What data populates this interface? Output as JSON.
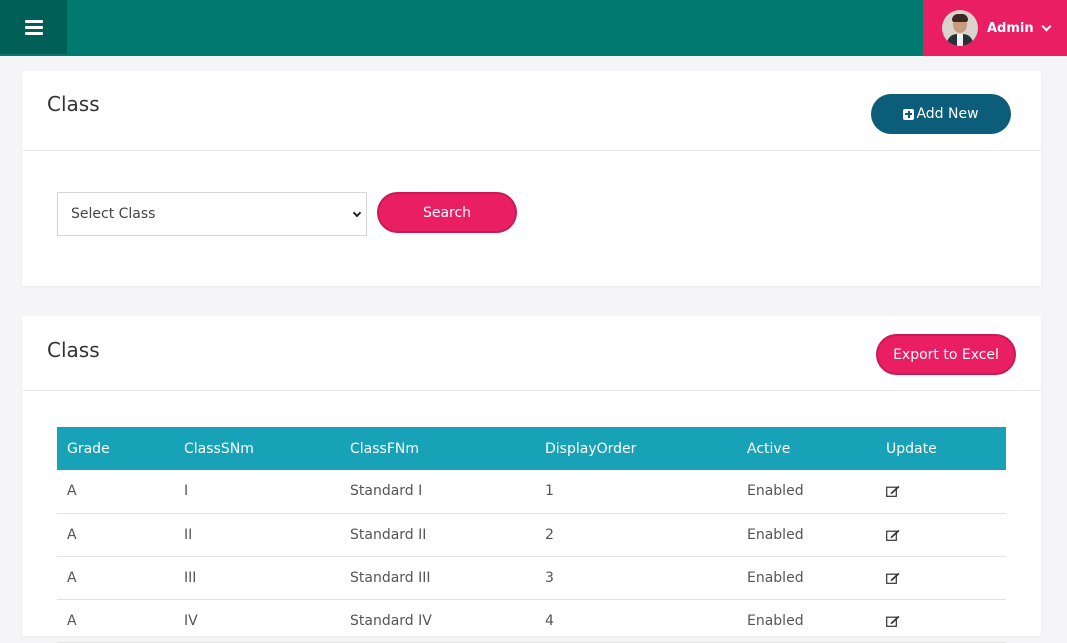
{
  "topbar": {
    "menu_icon": "hamburger-menu-icon",
    "user_name": "Admin",
    "colors": {
      "bar": "#00796f",
      "menu_bg": "#005f57",
      "user_bg": "#ea1f63"
    }
  },
  "filter_card": {
    "title": "Class",
    "add_new_label": "Add New",
    "select_placeholder": "Select Class",
    "search_label": "Search"
  },
  "list_card": {
    "title": "Class",
    "export_label": "Export to Excel",
    "columns": [
      "Grade",
      "ClassSNm",
      "ClassFNm",
      "DisplayOrder",
      "Active",
      "Update"
    ],
    "rows": [
      [
        "A",
        "I",
        "Standard I",
        "1",
        "Enabled"
      ],
      [
        "A",
        "II",
        "Standard II",
        "2",
        "Enabled"
      ],
      [
        "A",
        "III",
        "Standard III",
        "3",
        "Enabled"
      ],
      [
        "A",
        "IV",
        "Standard IV",
        "4",
        "Enabled"
      ]
    ],
    "row_action_icon": "edit-icon",
    "header_color": "#17a2b8"
  }
}
